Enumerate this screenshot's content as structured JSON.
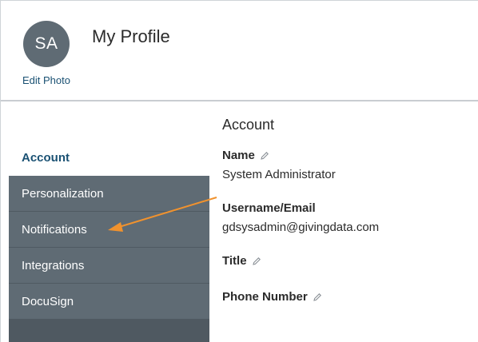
{
  "header": {
    "avatar_initials": "SA",
    "edit_photo_label": "Edit Photo",
    "page_title": "My Profile"
  },
  "sidebar": {
    "items": [
      {
        "label": "Account",
        "active": true
      },
      {
        "label": "Personalization",
        "active": false
      },
      {
        "label": "Notifications",
        "active": false
      },
      {
        "label": "Integrations",
        "active": false
      },
      {
        "label": "DocuSign",
        "active": false
      }
    ]
  },
  "account": {
    "section_title": "Account",
    "name_label": "Name",
    "name_value": "System Administrator",
    "username_label": "Username/Email",
    "username_value": "gdsysadmin@givingdata.com",
    "title_label": "Title",
    "phone_label": "Phone Number"
  },
  "annotation": {
    "arrow_color": "#f0922e",
    "arrow_target": "sidebar-item-notifications"
  },
  "colors": {
    "accent": "#1a5173",
    "sidebar_bg": "#5f6b74",
    "avatar_bg": "#5f6b74"
  }
}
